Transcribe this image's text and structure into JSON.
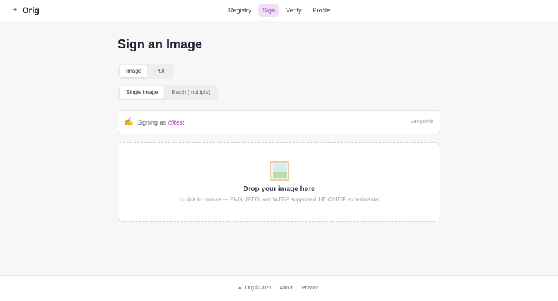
{
  "header": {
    "brand_icon": "sparkle-icon",
    "brand_mark": "✦",
    "brand_name": "Orig",
    "nav": [
      {
        "label": "Registry",
        "active": false
      },
      {
        "label": "Sign",
        "active": true
      },
      {
        "label": "Verify",
        "active": false
      },
      {
        "label": "Profile",
        "active": false
      }
    ]
  },
  "main": {
    "title": "Sign an Image",
    "type_tabs": [
      {
        "label": "Image",
        "active": true
      },
      {
        "label": "PDF",
        "active": false
      }
    ],
    "mode_tabs": [
      {
        "label": "Single image",
        "active": true
      },
      {
        "label": "Batch (multiple)",
        "active": false
      }
    ],
    "signing": {
      "icon": "writing-hand-icon",
      "glyph": "✍️",
      "prefix": "Signing as",
      "user": "@test",
      "edit_label": "Edit profile"
    },
    "dropzone": {
      "icon": "framed-picture-icon",
      "title": "Drop your image here",
      "subtitle": "or click to browse — PNG, JPEG, and WEBP supported. HEIC/HEIF experimental"
    }
  },
  "footer": {
    "mark": "✦",
    "brand": "Orig © 2026",
    "links": [
      "About",
      "Privacy"
    ]
  },
  "colors": {
    "accent": "#9a3cb8",
    "accent_bg": "#f1def7",
    "page_bg": "#f7f7f8"
  }
}
